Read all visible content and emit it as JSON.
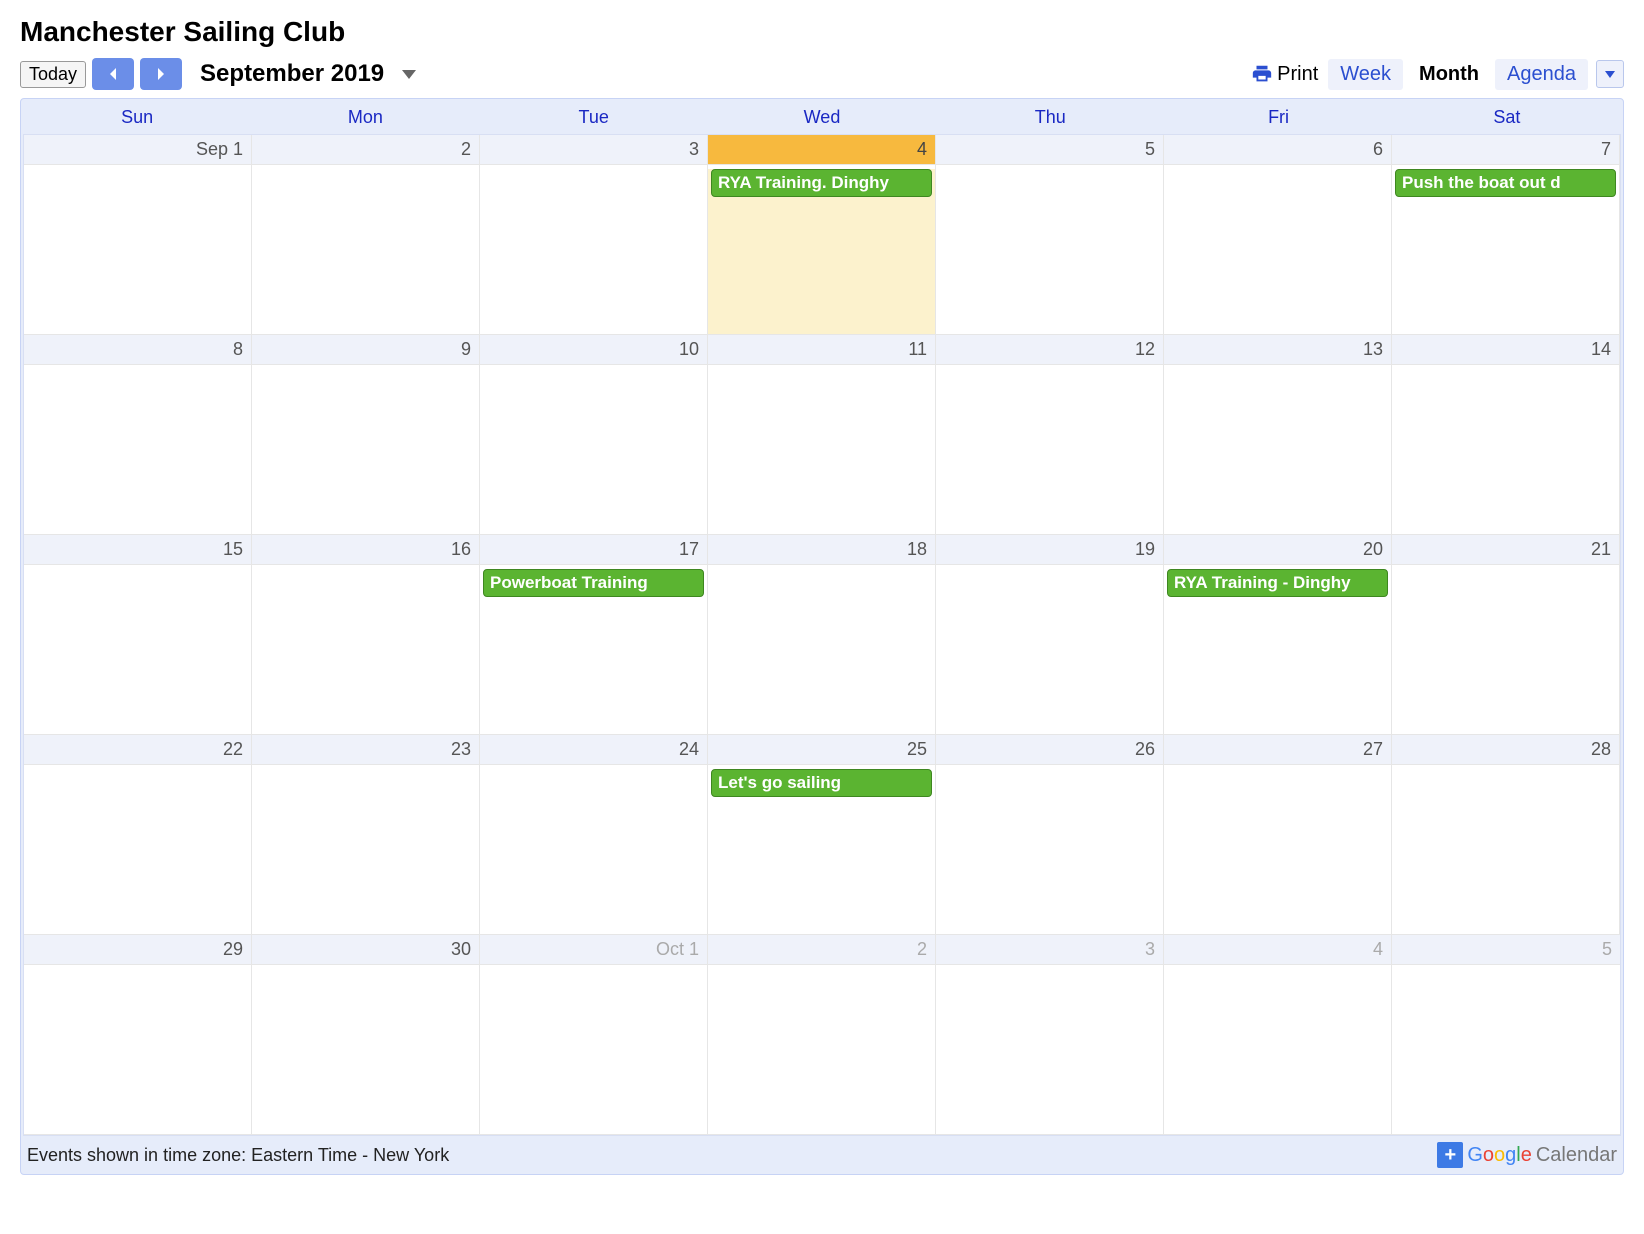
{
  "header": {
    "title": "Manchester Sailing Club"
  },
  "toolbar": {
    "today": "Today",
    "month_label": "September 2019",
    "print": "Print",
    "views": {
      "week": "Week",
      "month": "Month",
      "agenda": "Agenda"
    },
    "active_view": "month"
  },
  "day_headers": [
    "Sun",
    "Mon",
    "Tue",
    "Wed",
    "Thu",
    "Fri",
    "Sat"
  ],
  "cells": [
    {
      "label": "Sep 1",
      "dimmed": false,
      "today": false,
      "events": []
    },
    {
      "label": "2",
      "dimmed": false,
      "today": false,
      "events": []
    },
    {
      "label": "3",
      "dimmed": false,
      "today": false,
      "events": []
    },
    {
      "label": "4",
      "dimmed": false,
      "today": true,
      "events": [
        {
          "title": "RYA Training. Dinghy"
        }
      ]
    },
    {
      "label": "5",
      "dimmed": false,
      "today": false,
      "events": []
    },
    {
      "label": "6",
      "dimmed": false,
      "today": false,
      "events": []
    },
    {
      "label": "7",
      "dimmed": false,
      "today": false,
      "events": [
        {
          "title": "Push the boat out d"
        }
      ]
    },
    {
      "label": "8",
      "dimmed": false,
      "today": false,
      "events": []
    },
    {
      "label": "9",
      "dimmed": false,
      "today": false,
      "events": []
    },
    {
      "label": "10",
      "dimmed": false,
      "today": false,
      "events": []
    },
    {
      "label": "11",
      "dimmed": false,
      "today": false,
      "events": []
    },
    {
      "label": "12",
      "dimmed": false,
      "today": false,
      "events": []
    },
    {
      "label": "13",
      "dimmed": false,
      "today": false,
      "events": []
    },
    {
      "label": "14",
      "dimmed": false,
      "today": false,
      "events": []
    },
    {
      "label": "15",
      "dimmed": false,
      "today": false,
      "events": []
    },
    {
      "label": "16",
      "dimmed": false,
      "today": false,
      "events": []
    },
    {
      "label": "17",
      "dimmed": false,
      "today": false,
      "events": [
        {
          "title": "Powerboat Training"
        }
      ]
    },
    {
      "label": "18",
      "dimmed": false,
      "today": false,
      "events": []
    },
    {
      "label": "19",
      "dimmed": false,
      "today": false,
      "events": []
    },
    {
      "label": "20",
      "dimmed": false,
      "today": false,
      "events": [
        {
          "title": "RYA Training - Dinghy"
        }
      ]
    },
    {
      "label": "21",
      "dimmed": false,
      "today": false,
      "events": []
    },
    {
      "label": "22",
      "dimmed": false,
      "today": false,
      "events": []
    },
    {
      "label": "23",
      "dimmed": false,
      "today": false,
      "events": []
    },
    {
      "label": "24",
      "dimmed": false,
      "today": false,
      "events": []
    },
    {
      "label": "25",
      "dimmed": false,
      "today": false,
      "events": [
        {
          "title": "Let's go sailing"
        }
      ]
    },
    {
      "label": "26",
      "dimmed": false,
      "today": false,
      "events": []
    },
    {
      "label": "27",
      "dimmed": false,
      "today": false,
      "events": []
    },
    {
      "label": "28",
      "dimmed": false,
      "today": false,
      "events": []
    },
    {
      "label": "29",
      "dimmed": false,
      "today": false,
      "events": []
    },
    {
      "label": "30",
      "dimmed": false,
      "today": false,
      "events": []
    },
    {
      "label": "Oct 1",
      "dimmed": true,
      "today": false,
      "events": []
    },
    {
      "label": "2",
      "dimmed": true,
      "today": false,
      "events": []
    },
    {
      "label": "3",
      "dimmed": true,
      "today": false,
      "events": []
    },
    {
      "label": "4",
      "dimmed": true,
      "today": false,
      "events": []
    },
    {
      "label": "5",
      "dimmed": true,
      "today": false,
      "events": []
    }
  ],
  "footer": {
    "timezone_text": "Events shown in time zone: Eastern Time - New York",
    "gcal_brand": "Calendar"
  }
}
